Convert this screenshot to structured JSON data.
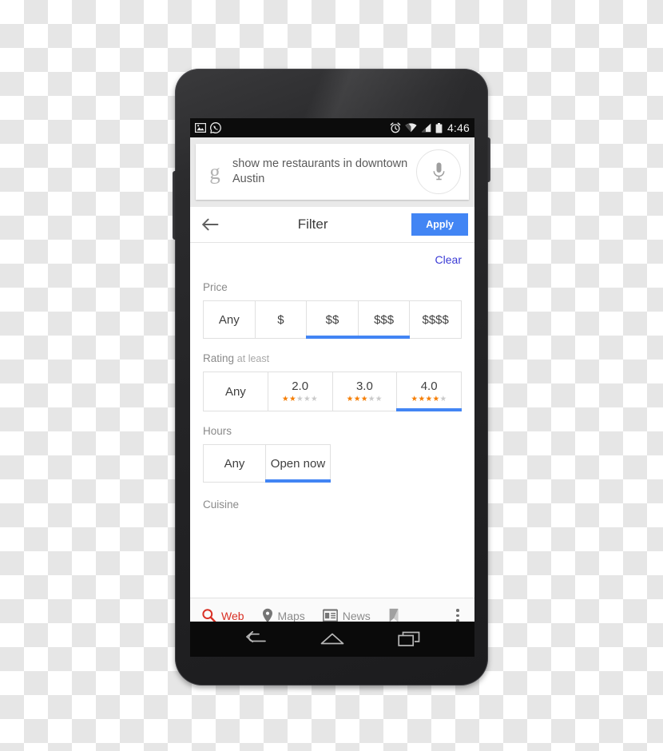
{
  "device": {
    "name": "android-smartphone",
    "status_bar": {
      "left_icons": [
        "screenshot-image-icon",
        "whatsapp-icon"
      ],
      "right_icons": [
        "alarm-clock-icon",
        "wifi-icon",
        "cell-signal-icon",
        "battery-icon"
      ],
      "clock": "4:46"
    },
    "nav_bar": {
      "back_label": "back-nav-button",
      "home_label": "home-nav-button",
      "recents_label": "recent-apps-nav-button"
    }
  },
  "search": {
    "logo": "g",
    "query": "show me restaurants in downtown Austin",
    "mic_icon": "microphone-icon"
  },
  "filter_header": {
    "back_icon": "back-arrow-icon",
    "title": "Filter",
    "apply_label": "Apply",
    "apply_color": "#4285f4"
  },
  "filter_body": {
    "clear_label": "Clear",
    "clear_color": "#3b3bd6",
    "selected_underline_color": "#4285f4",
    "star_on_color": "#f57c00",
    "star_off_color": "#c9c9c9",
    "sections": [
      {
        "key": "price",
        "label": "Price",
        "sub_label": "",
        "options": [
          {
            "label": "Any",
            "selected": false,
            "stars_on": 0,
            "stars_off": 0
          },
          {
            "label": "$",
            "selected": false,
            "stars_on": 0,
            "stars_off": 0
          },
          {
            "label": "$$",
            "selected": true,
            "stars_on": 0,
            "stars_off": 0
          },
          {
            "label": "$$$",
            "selected": true,
            "stars_on": 0,
            "stars_off": 0
          },
          {
            "label": "$$$$",
            "selected": false,
            "stars_on": 0,
            "stars_off": 0
          }
        ]
      },
      {
        "key": "rating",
        "label": "Rating",
        "sub_label": "at least",
        "options": [
          {
            "label": "Any",
            "selected": false,
            "stars_on": 0,
            "stars_off": 0
          },
          {
            "label": "2.0",
            "selected": false,
            "stars_on": 2,
            "stars_off": 3
          },
          {
            "label": "3.0",
            "selected": false,
            "stars_on": 3,
            "stars_off": 2
          },
          {
            "label": "4.0",
            "selected": true,
            "stars_on": 4,
            "stars_off": 1
          }
        ]
      },
      {
        "key": "hours",
        "label": "Hours",
        "sub_label": "",
        "options": [
          {
            "label": "Any",
            "selected": false,
            "stars_on": 0,
            "stars_off": 0
          },
          {
            "label": "Open now",
            "selected": true,
            "stars_on": 0,
            "stars_off": 0
          }
        ]
      }
    ],
    "partial_section_label": "Cuisine"
  },
  "tab_bar": {
    "tabs": [
      {
        "label": "Web",
        "icon": "search-icon",
        "active": true
      },
      {
        "label": "Maps",
        "icon": "map-pin-icon",
        "active": false
      },
      {
        "label": "News",
        "icon": "newspaper-icon",
        "active": false
      },
      {
        "label": "",
        "icon": "bookmark-tag-icon",
        "active": false
      }
    ],
    "overflow_icon": "overflow-menu-icon",
    "active_color": "#d93025"
  }
}
